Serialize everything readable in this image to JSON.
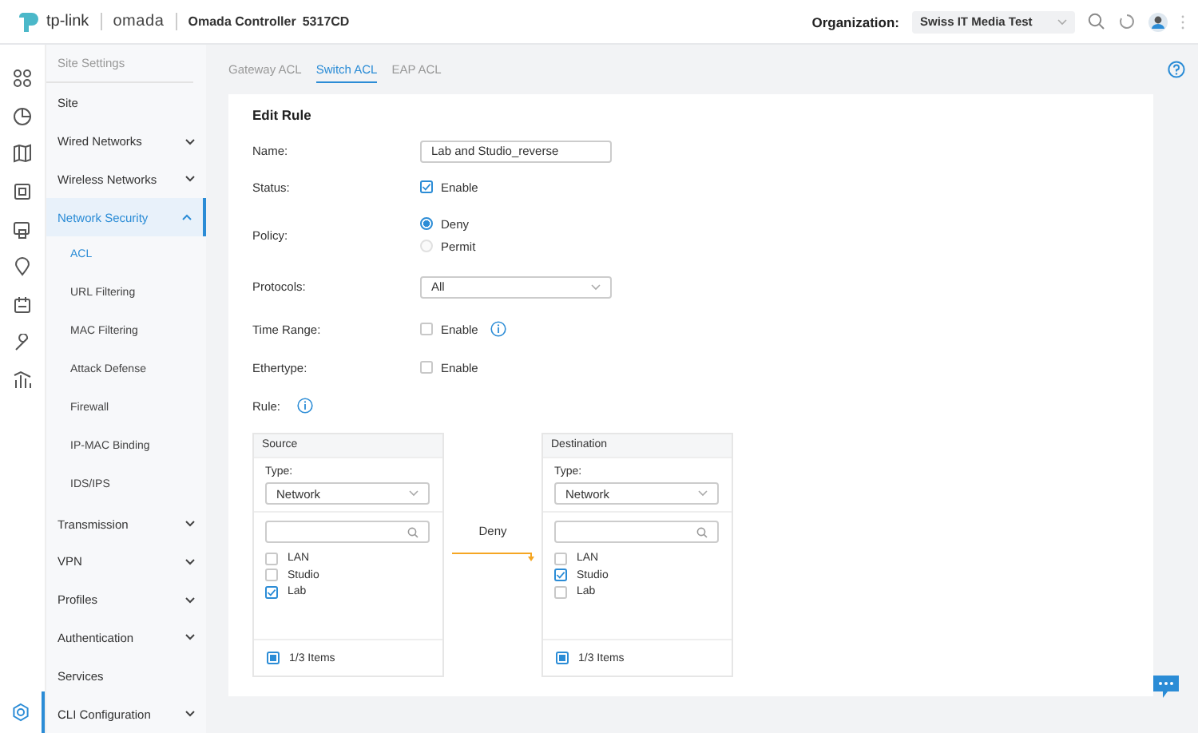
{
  "header": {
    "logo_brand": "tp-link",
    "logo_product": "omada",
    "controller_name": "Omada Controller",
    "controller_id": "5317CD",
    "organization_label": "Organization:",
    "organization_value": "Swiss IT Media Test"
  },
  "rail": [
    {
      "selected": false
    },
    {
      "selected": false
    },
    {
      "selected": false
    },
    {
      "selected": false
    },
    {
      "selected": false
    },
    {
      "selected": false
    },
    {
      "selected": false
    },
    {
      "selected": false
    },
    {
      "selected": false
    },
    {
      "selected": true
    }
  ],
  "sidebar": {
    "title": "Site Settings",
    "items": [
      {
        "label": "Site",
        "kind": "link",
        "selected": false
      },
      {
        "label": "Wired Networks",
        "kind": "group",
        "expanded": false,
        "selected": false
      },
      {
        "label": "Wireless Networks",
        "kind": "group",
        "expanded": false,
        "selected": false
      },
      {
        "label": "Network Security",
        "kind": "group",
        "expanded": true,
        "selected": true,
        "children": [
          {
            "label": "ACL",
            "selected": true
          },
          {
            "label": "URL Filtering",
            "selected": false
          },
          {
            "label": "MAC Filtering",
            "selected": false
          },
          {
            "label": "Attack Defense",
            "selected": false
          },
          {
            "label": "Firewall",
            "selected": false
          },
          {
            "label": "IP-MAC Binding",
            "selected": false
          },
          {
            "label": "IDS/IPS",
            "selected": false
          }
        ]
      },
      {
        "label": "Transmission",
        "kind": "group",
        "expanded": false,
        "selected": false
      },
      {
        "label": "VPN",
        "kind": "group",
        "expanded": false,
        "selected": false
      },
      {
        "label": "Profiles",
        "kind": "group",
        "expanded": false,
        "selected": false
      },
      {
        "label": "Authentication",
        "kind": "group",
        "expanded": false,
        "selected": false
      },
      {
        "label": "Services",
        "kind": "link",
        "selected": false
      },
      {
        "label": "CLI Configuration",
        "kind": "group",
        "expanded": false,
        "selected": false
      }
    ]
  },
  "tabs": [
    {
      "label": "Gateway ACL",
      "selected": false
    },
    {
      "label": "Switch ACL",
      "selected": true
    },
    {
      "label": "EAP ACL",
      "selected": false
    }
  ],
  "form": {
    "title": "Edit Rule",
    "name_label": "Name:",
    "name_value": "Lab and Studio_reverse",
    "status_label": "Status:",
    "status": {
      "label": "Enable",
      "checked": true
    },
    "policy_label": "Policy:",
    "policy_options": [
      {
        "label": "Deny",
        "selected": true
      },
      {
        "label": "Permit",
        "selected": false
      }
    ],
    "protocols_label": "Protocols:",
    "protocols_value": "All",
    "time_range_label": "Time Range:",
    "time_range": {
      "label": "Enable",
      "checked": false
    },
    "ethertype_label": "Ethertype:",
    "ethertype": {
      "label": "Enable",
      "checked": false
    },
    "rule_label": "Rule:"
  },
  "rule": {
    "source": {
      "title": "Source",
      "type_label": "Type:",
      "type_value": "Network",
      "items": [
        {
          "label": "LAN",
          "checked": false
        },
        {
          "label": "Studio",
          "checked": false
        },
        {
          "label": "Lab",
          "checked": true
        }
      ],
      "footer": "1/3 Items",
      "indeterminate": true
    },
    "action": "Deny",
    "destination": {
      "title": "Destination",
      "type_label": "Type:",
      "type_value": "Network",
      "items": [
        {
          "label": "LAN",
          "checked": false
        },
        {
          "label": "Studio",
          "checked": true
        },
        {
          "label": "Lab",
          "checked": false
        }
      ],
      "footer": "1/3 Items",
      "indeterminate": true
    }
  }
}
